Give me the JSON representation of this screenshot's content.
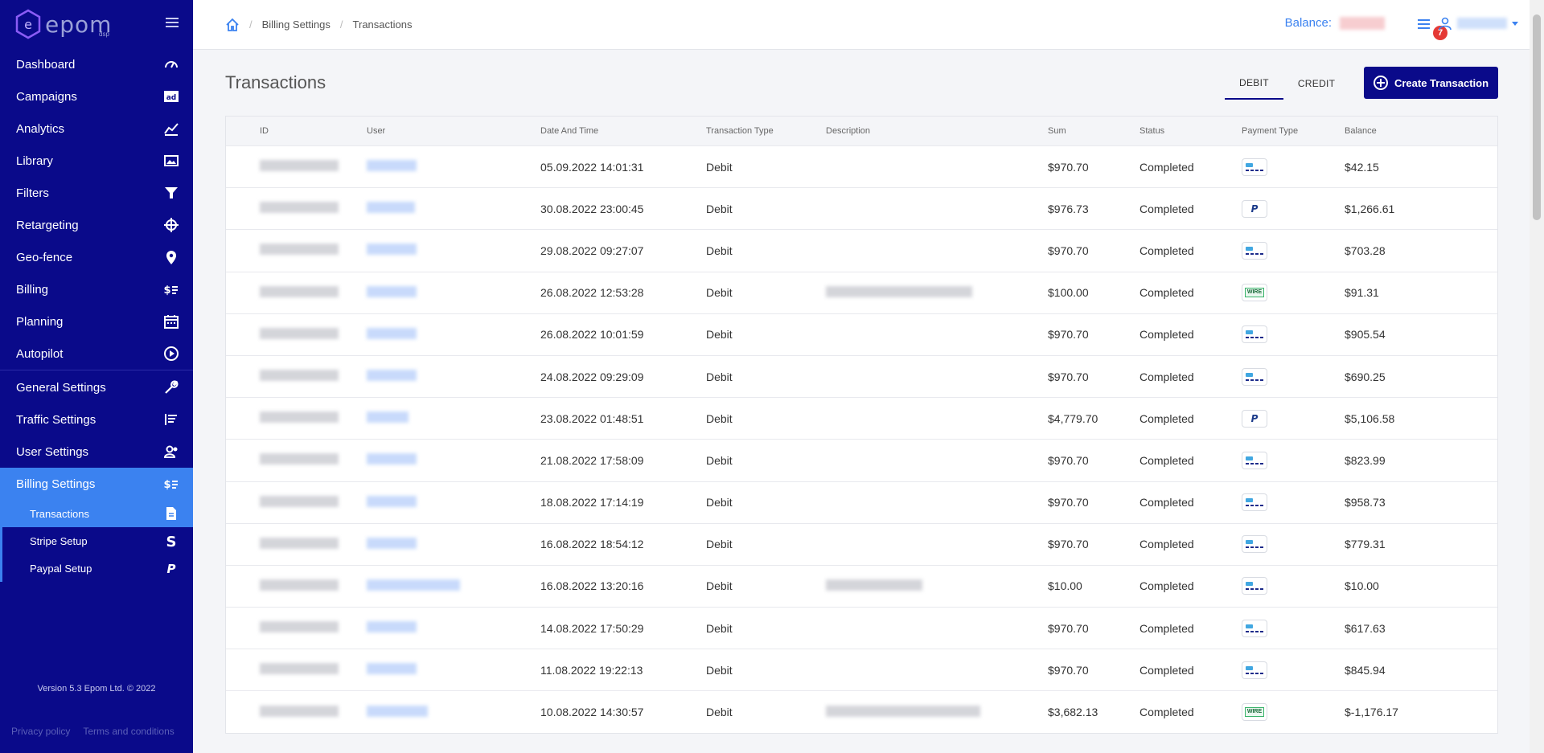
{
  "brand": {
    "name": "epom",
    "sub": "dsp"
  },
  "sidebar": {
    "items": [
      {
        "label": "Dashboard",
        "icon": "gauge-icon"
      },
      {
        "label": "Campaigns",
        "icon": "ad-icon"
      },
      {
        "label": "Analytics",
        "icon": "chart-line-icon"
      },
      {
        "label": "Library",
        "icon": "image-icon"
      },
      {
        "label": "Filters",
        "icon": "funnel-icon"
      },
      {
        "label": "Retargeting",
        "icon": "crosshair-icon"
      },
      {
        "label": "Geo-fence",
        "icon": "map-pin-icon"
      },
      {
        "label": "Billing",
        "icon": "dollar-list-icon"
      },
      {
        "label": "Planning",
        "icon": "calendar-icon"
      },
      {
        "label": "Autopilot",
        "icon": "play-circle-icon"
      }
    ],
    "settings": [
      {
        "label": "General Settings",
        "icon": "wrench-icon"
      },
      {
        "label": "Traffic Settings",
        "icon": "list-icon"
      },
      {
        "label": "User Settings",
        "icon": "user-gear-icon"
      },
      {
        "label": "Billing Settings",
        "icon": "dollar-list-icon"
      }
    ],
    "subitems": [
      {
        "label": "Transactions",
        "icon": "document-icon"
      },
      {
        "label": "Stripe Setup",
        "icon": "stripe-icon"
      },
      {
        "label": "Paypal Setup",
        "icon": "paypal-icon"
      }
    ],
    "version": "Version 5.3 Epom Ltd. © 2022",
    "privacy": "Privacy policy",
    "terms": "Terms and conditions"
  },
  "header": {
    "breadcrumb": [
      "Billing Settings",
      "Transactions"
    ],
    "balance_label": "Balance:",
    "notifications_count": "7"
  },
  "main": {
    "title": "Transactions",
    "tabs": [
      "DEBIT",
      "CREDIT"
    ],
    "create_label": "Create Transaction",
    "columns": [
      "ID",
      "User",
      "Date And Time",
      "Transaction Type",
      "Description",
      "Sum",
      "Status",
      "Payment Type",
      "Balance"
    ],
    "rows": [
      {
        "date": "05.09.2022 14:01:31",
        "type": "Debit",
        "sum": "$970.70",
        "status": "Completed",
        "pay": "card",
        "balance": "$42.15"
      },
      {
        "date": "30.08.2022 23:00:45",
        "type": "Debit",
        "sum": "$976.73",
        "status": "Completed",
        "pay": "paypal",
        "balance": "$1,266.61"
      },
      {
        "date": "29.08.2022 09:27:07",
        "type": "Debit",
        "sum": "$970.70",
        "status": "Completed",
        "pay": "card",
        "balance": "$703.28"
      },
      {
        "date": "26.08.2022 12:53:28",
        "type": "Debit",
        "sum": "$100.00",
        "status": "Completed",
        "pay": "wire",
        "balance": "$91.31"
      },
      {
        "date": "26.08.2022 10:01:59",
        "type": "Debit",
        "sum": "$970.70",
        "status": "Completed",
        "pay": "card",
        "balance": "$905.54"
      },
      {
        "date": "24.08.2022 09:29:09",
        "type": "Debit",
        "sum": "$970.70",
        "status": "Completed",
        "pay": "card",
        "balance": "$690.25"
      },
      {
        "date": "23.08.2022 01:48:51",
        "type": "Debit",
        "sum": "$4,779.70",
        "status": "Completed",
        "pay": "paypal",
        "balance": "$5,106.58"
      },
      {
        "date": "21.08.2022 17:58:09",
        "type": "Debit",
        "sum": "$970.70",
        "status": "Completed",
        "pay": "card",
        "balance": "$823.99"
      },
      {
        "date": "18.08.2022 17:14:19",
        "type": "Debit",
        "sum": "$970.70",
        "status": "Completed",
        "pay": "card",
        "balance": "$958.73"
      },
      {
        "date": "16.08.2022 18:54:12",
        "type": "Debit",
        "sum": "$970.70",
        "status": "Completed",
        "pay": "card",
        "balance": "$779.31"
      },
      {
        "date": "16.08.2022 13:20:16",
        "type": "Debit",
        "sum": "$10.00",
        "status": "Completed",
        "pay": "card",
        "balance": "$10.00"
      },
      {
        "date": "14.08.2022 17:50:29",
        "type": "Debit",
        "sum": "$970.70",
        "status": "Completed",
        "pay": "card",
        "balance": "$617.63"
      },
      {
        "date": "11.08.2022 19:22:13",
        "type": "Debit",
        "sum": "$970.70",
        "status": "Completed",
        "pay": "card",
        "balance": "$845.94"
      },
      {
        "date": "10.08.2022 14:30:57",
        "type": "Debit",
        "sum": "$3,682.13",
        "status": "Completed",
        "pay": "wire",
        "balance": "$-1,176.17"
      }
    ]
  },
  "colors": {
    "sidebar_bg": "#0a0a8a",
    "accent": "#3b82f0",
    "badge": "#e53935"
  }
}
